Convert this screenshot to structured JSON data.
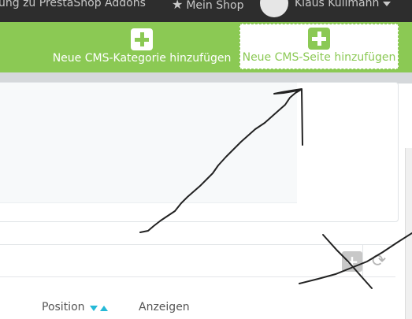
{
  "topbar": {
    "addons_link": "ung zu PrestaShop Addons",
    "shop_link": "Mein Shop",
    "user_name": "Klaus Kullmann"
  },
  "toolbar": {
    "add_category_label": "Neue CMS-Kategorie hinzufügen",
    "add_page_label": "Neue CMS-Seite hinzufügen"
  },
  "list": {
    "columns": {
      "position": "Position",
      "display": "Anzeigen"
    }
  },
  "icons": {
    "shop": "star-icon",
    "add": "plus-icon",
    "refresh": "refresh-icon",
    "sort_desc": "sort-down-icon",
    "sort_asc": "sort-up-icon",
    "user": "avatar",
    "user_menu": "caret-down-icon"
  },
  "colors": {
    "toolbar": "#8bc954",
    "topbar": "#2d2d2d",
    "sort_arrows": "#25b9d7"
  }
}
